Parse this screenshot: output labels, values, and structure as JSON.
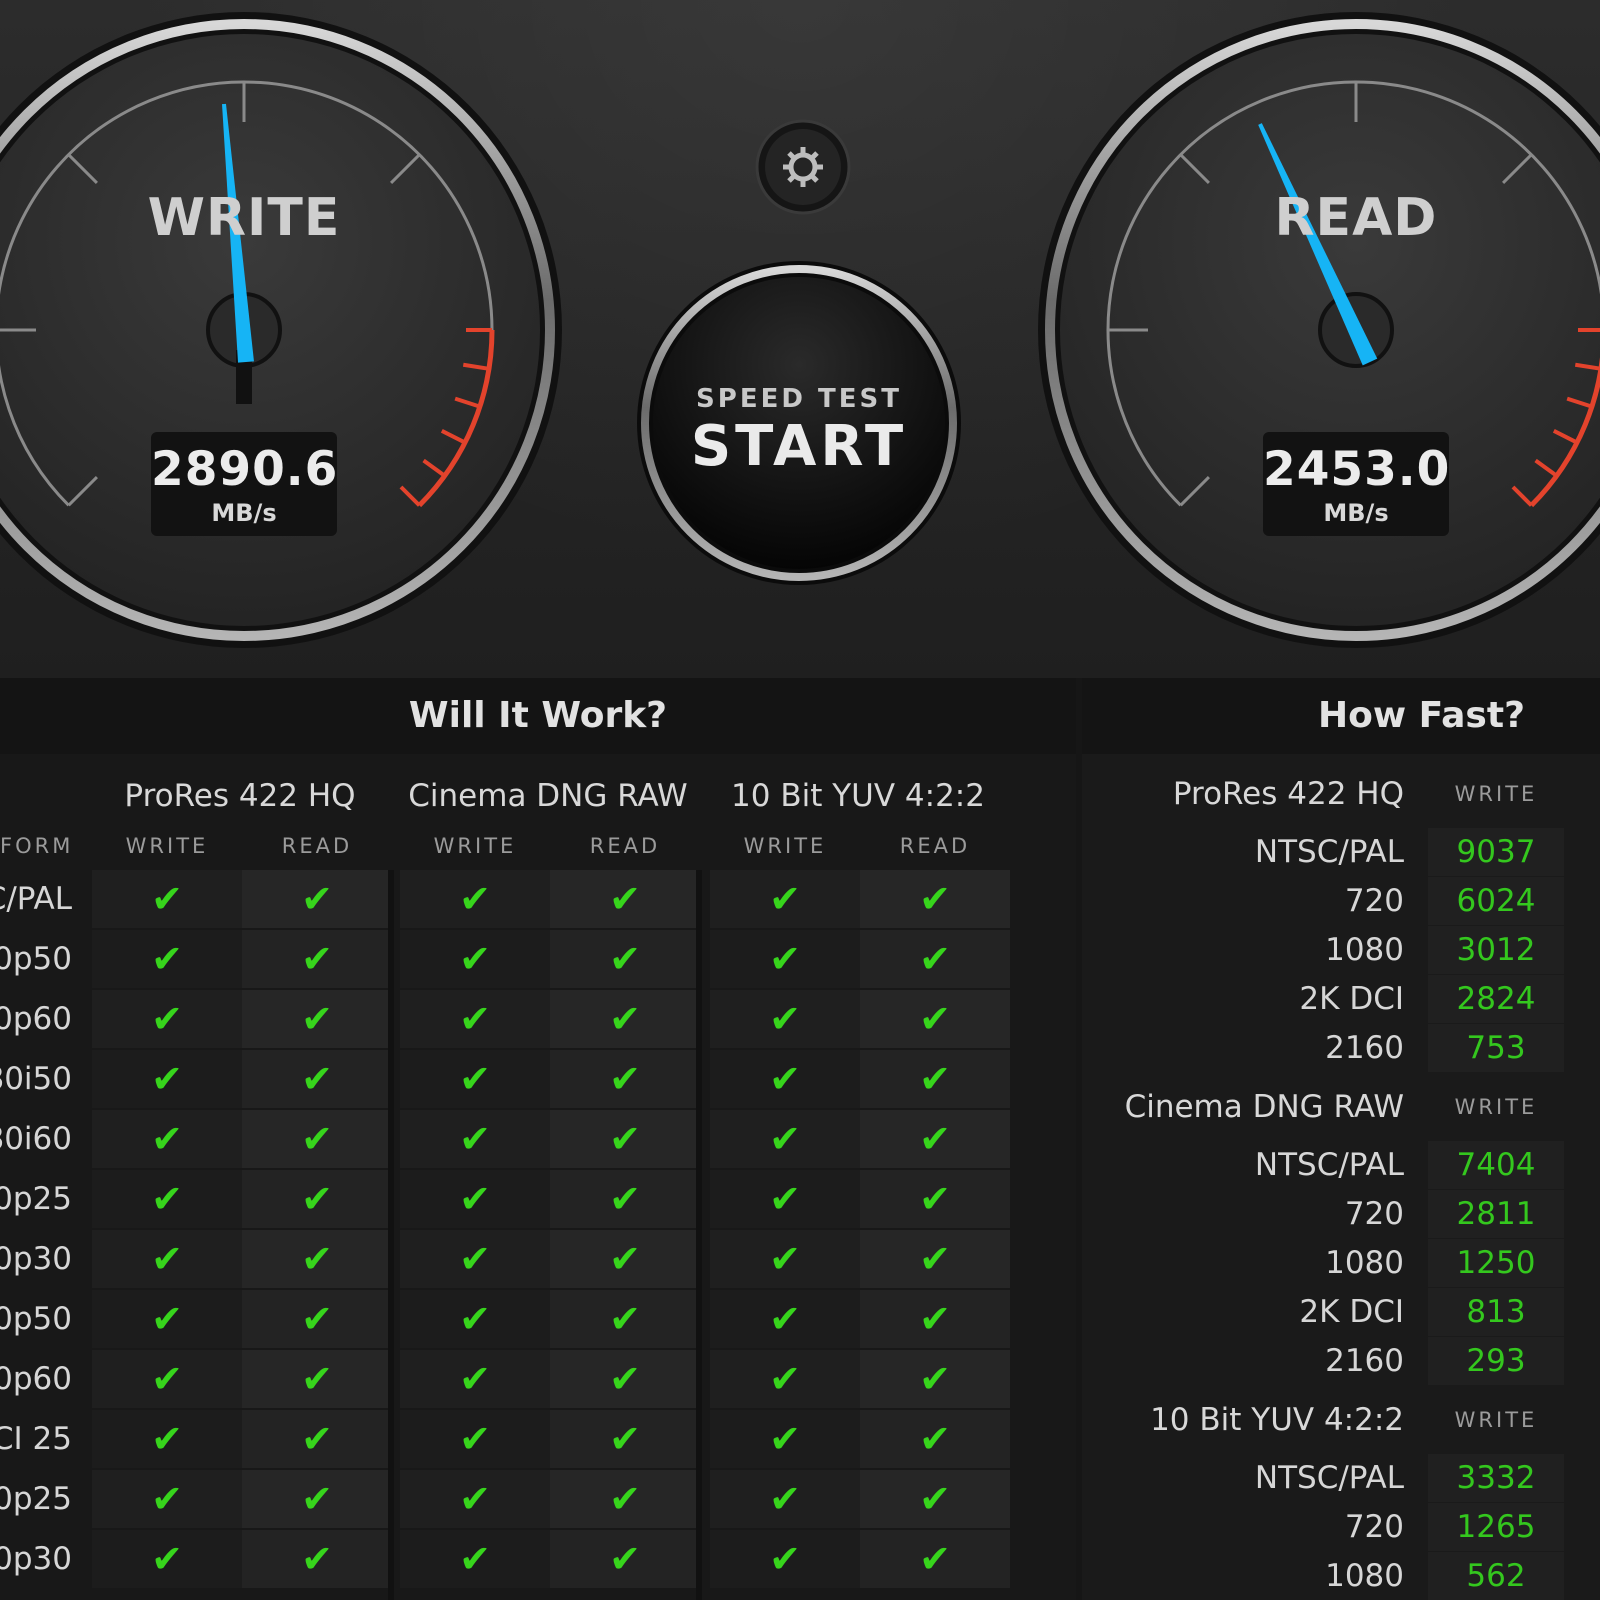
{
  "gauges": {
    "write": {
      "title": "WRITE",
      "value": "2890.6",
      "unit": "MB/s"
    },
    "read": {
      "title": "READ",
      "value": "2453.0",
      "unit": "MB/s"
    }
  },
  "start_button": {
    "top_label": "SPEED TEST",
    "main_label": "START"
  },
  "settings": {
    "icon": "gear-icon"
  },
  "will_it_work": {
    "title": "Will It Work?",
    "format_header": "FORMAT",
    "groups": [
      "ProRes 422 HQ",
      "Cinema DNG RAW",
      "10 Bit YUV 4:2:2"
    ],
    "col_write": "WRITE",
    "col_read": "READ",
    "check_mark": "✔",
    "rows": [
      "C/PAL",
      "0p50",
      "0p60",
      "80i50",
      "80i60",
      "0p25",
      "0p30",
      "0p50",
      "0p60",
      "CI 25",
      "0p25",
      "0p30"
    ]
  },
  "how_fast": {
    "title": "How Fast?",
    "col_write": "WRITE",
    "groups": [
      {
        "name": "ProRes 422 HQ",
        "rows": [
          {
            "label": "NTSC/PAL",
            "write": "9037"
          },
          {
            "label": "720",
            "write": "6024"
          },
          {
            "label": "1080",
            "write": "3012"
          },
          {
            "label": "2K DCI",
            "write": "2824"
          },
          {
            "label": "2160",
            "write": "753"
          }
        ]
      },
      {
        "name": "Cinema DNG RAW",
        "rows": [
          {
            "label": "NTSC/PAL",
            "write": "7404"
          },
          {
            "label": "720",
            "write": "2811"
          },
          {
            "label": "1080",
            "write": "1250"
          },
          {
            "label": "2K DCI",
            "write": "813"
          },
          {
            "label": "2160",
            "write": "293"
          }
        ]
      },
      {
        "name": "10 Bit YUV 4:2:2",
        "rows": [
          {
            "label": "NTSC/PAL",
            "write": "3332"
          },
          {
            "label": "720",
            "write": "1265"
          },
          {
            "label": "1080",
            "write": "562"
          }
        ]
      }
    ]
  },
  "colors": {
    "needle": "#16b4f5",
    "check": "#37d41c",
    "value_green": "#34c71e",
    "redline": "#e3432c"
  }
}
